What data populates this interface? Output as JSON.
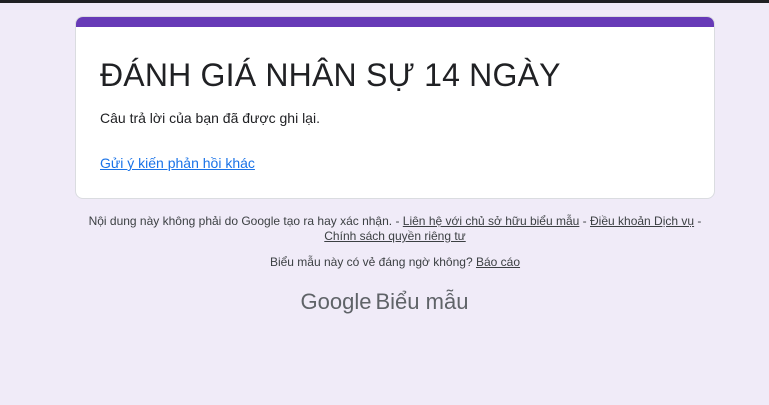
{
  "form": {
    "title": "ĐÁNH GIÁ NHÂN SỰ 14 NGÀY",
    "confirmation": "Câu trả lời của bạn đã được ghi lại.",
    "another_response_link": "Gửi ý kiến phản hồi khác",
    "accent_color": "#673ab7"
  },
  "footer": {
    "disclaimer": "Nội dung này không phải do Google tạo ra hay xác nhận.",
    "sep": " - ",
    "contact_owner_link": "Liên hệ với chủ sở hữu biểu mẫu",
    "terms_link": "Điều khoản Dịch vụ",
    "privacy_link": "Chính sách quyền riêng tư",
    "suspicious_question": "Biểu mẫu này có vẻ đáng ngờ không?",
    "report_link": "Báo cáo"
  },
  "brand": {
    "google": "Google",
    "product": "Biểu mẫu"
  }
}
